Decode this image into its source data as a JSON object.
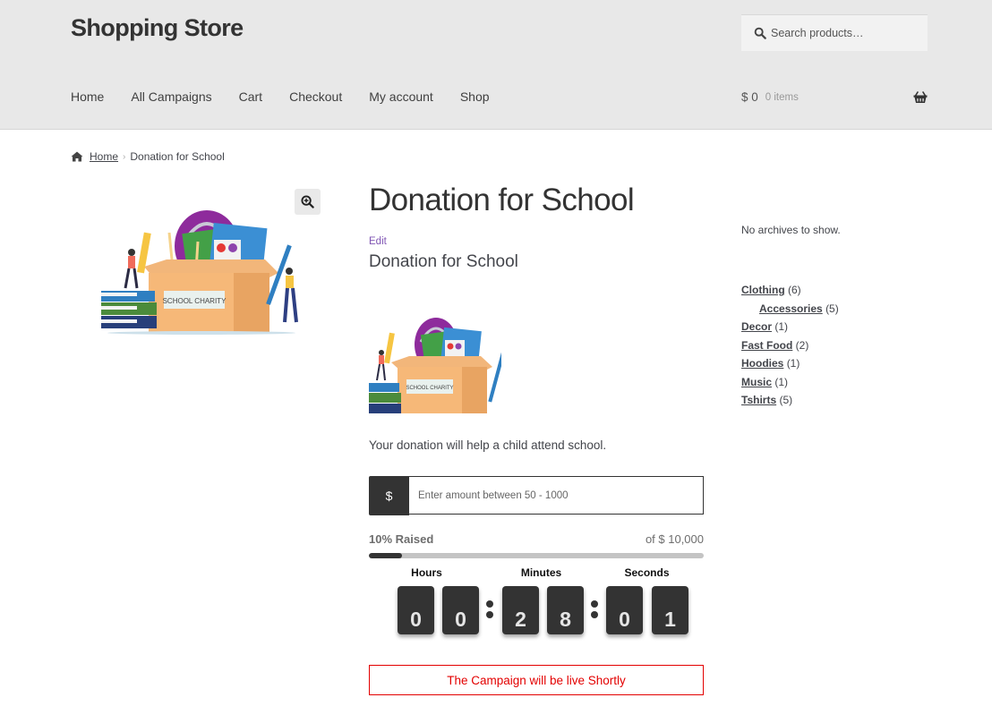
{
  "header": {
    "site_title": "Shopping Store",
    "search_placeholder": "Search products…",
    "nav": [
      {
        "label": "Home"
      },
      {
        "label": "All Campaigns"
      },
      {
        "label": "Cart"
      },
      {
        "label": "Checkout"
      },
      {
        "label": "My account"
      },
      {
        "label": "Shop"
      }
    ],
    "cart": {
      "amount": "$ 0",
      "count": "0 items",
      "icon": "basket-icon"
    }
  },
  "breadcrumb": {
    "home_icon": "home-icon",
    "home_label": "Home",
    "separator": "›",
    "current": "Donation for School"
  },
  "gallery": {
    "zoom_icon": "magnify-plus-icon",
    "image_label": "SCHOOL CHARITY"
  },
  "product": {
    "title": "Donation for School",
    "edit_label": "Edit",
    "subtitle": "Donation for School",
    "description": "Your donation will help a child attend school.",
    "currency_symbol": "$",
    "amount_placeholder": "Enter amount between 50 - 1000",
    "raised_label": "10% Raised",
    "raised_percent": 10,
    "goal_label": "of $ 10,000",
    "countdown": {
      "hours_label": "Hours",
      "minutes_label": "Minutes",
      "seconds_label": "Seconds",
      "digits": [
        "0",
        "0",
        "2",
        "8",
        "0",
        "1"
      ]
    },
    "notice": "The Campaign will be live Shortly"
  },
  "sidebar": {
    "archives_empty": "No archives to show.",
    "categories": [
      {
        "name": "Clothing",
        "count": "(6)",
        "child": false
      },
      {
        "name": "Accessories",
        "count": "(5)",
        "child": true
      },
      {
        "name": "Decor",
        "count": "(1)",
        "child": false
      },
      {
        "name": "Fast Food",
        "count": "(2)",
        "child": false
      },
      {
        "name": "Hoodies",
        "count": "(1)",
        "child": false
      },
      {
        "name": "Music",
        "count": "(1)",
        "child": false
      },
      {
        "name": "Tshirts",
        "count": "(5)",
        "child": false
      }
    ]
  },
  "colors": {
    "header_bg": "#e8e8e8",
    "dark": "#333333",
    "edit_link": "#7f54b3",
    "notice_red": "#e30000"
  }
}
